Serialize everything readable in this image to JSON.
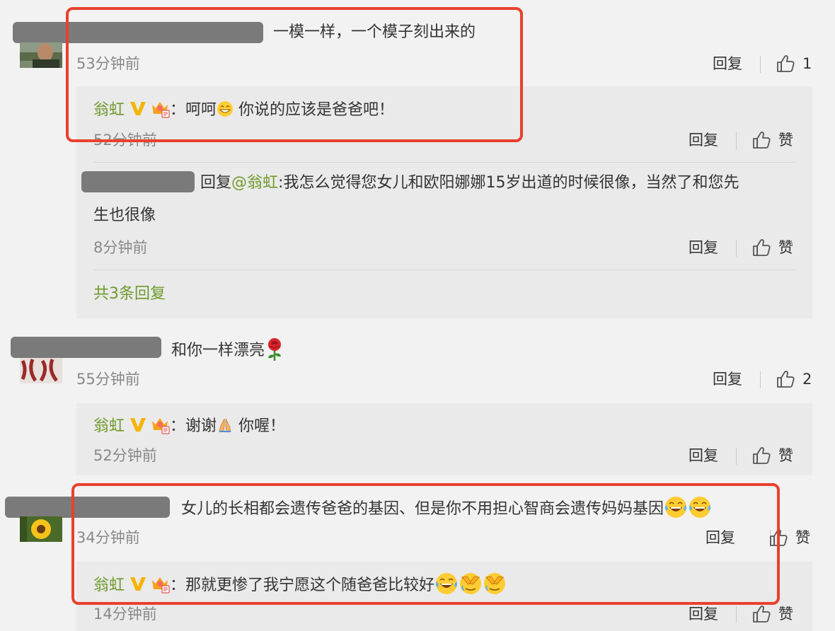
{
  "comments": [
    {
      "text": "一模一样，一个模子刻出来的",
      "time": "53分钟前",
      "reply_label": "回复",
      "like_count": "1",
      "replies": [
        {
          "author": "翁虹",
          "colon": "：",
          "prefix": "呵呵",
          "suffix": " 你说的应该是爸爸吧！",
          "time": "52分钟前",
          "reply_label": "回复",
          "like_label": "赞"
        },
        {
          "reply_prefix": "回复",
          "mention": "@翁虹",
          "text_line1": ":我怎么觉得您女儿和欧阳娜娜15岁出道的时候很像，当然了和您先",
          "text_line2": "生也很像",
          "time": "8分钟前",
          "reply_label": "回复",
          "like_label": "赞"
        }
      ],
      "more_replies": "共3条回复"
    },
    {
      "text": "和你一样漂亮",
      "time": "55分钟前",
      "reply_label": "回复",
      "like_count": "2",
      "replies": [
        {
          "author": "翁虹",
          "colon": "：",
          "prefix": "谢谢",
          "suffix": " 你喔！",
          "time": "52分钟前",
          "reply_label": "回复",
          "like_label": "赞"
        }
      ]
    },
    {
      "text": "女儿的长相都会遗传爸爸的基因、但是你不用担心智商会遗传妈妈基因",
      "time": "34分钟前",
      "reply_label": "回复",
      "like_label": "赞",
      "replies": [
        {
          "author": "翁虹",
          "colon": "：",
          "prefix": "那就更惨了我宁愿这个随爸爸比较好",
          "time": "14分钟前",
          "reply_label": "回复",
          "like_label": "赞"
        }
      ]
    }
  ],
  "colors": {
    "accent_green": "#6f9a2b",
    "highlight_red": "#e8412e",
    "background": "#f2f2f2",
    "reply_background": "#eaeaea"
  },
  "icons": [
    "thumbs-up-icon",
    "verified-v-icon",
    "crown-member-icon",
    "grin-emoji-icon",
    "pray-emoji-icon",
    "rose-emoji-icon",
    "laugh-cry-emoji-icon",
    "facepalm-cry-emoji-icon"
  ]
}
